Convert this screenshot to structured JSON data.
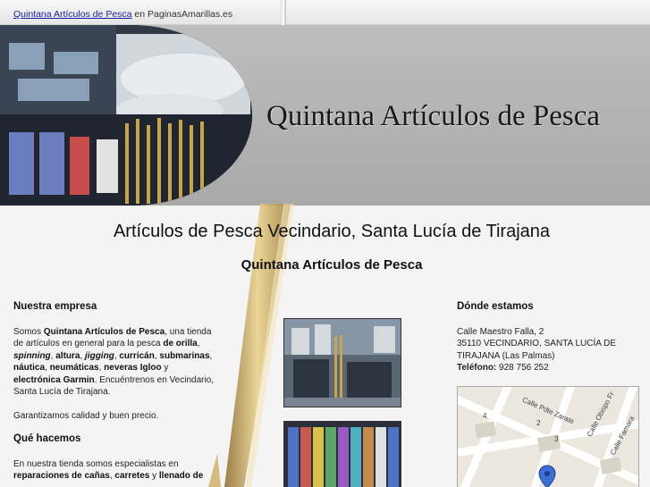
{
  "topbar": {
    "link_text": "Quintana Artículos de Pesca",
    "suffix_text": " en PaginasAmarillas.es"
  },
  "banner": {
    "title": "Quintana Artículos de Pesca"
  },
  "main": {
    "heading": "Artículos de Pesca Vecindario, Santa Lucía de Tirajana",
    "subheading": "Quintana Artículos de Pesca"
  },
  "empresa": {
    "title": "Nuestra empresa",
    "p1": [
      {
        "t": "Somos ",
        "b": false
      },
      {
        "t": "Quintana Artículos de Pesca",
        "b": true
      },
      {
        "t": ", una tienda de artículos en general para la pesca ",
        "b": false
      },
      {
        "t": "de orilla",
        "b": true
      },
      {
        "t": ", ",
        "b": false
      },
      {
        "t": "spinning",
        "b": true,
        "i": true
      },
      {
        "t": ", ",
        "b": false
      },
      {
        "t": "altura",
        "b": true
      },
      {
        "t": ", ",
        "b": false
      },
      {
        "t": "jigging",
        "b": true,
        "i": true
      },
      {
        "t": ", ",
        "b": false
      },
      {
        "t": "curricán",
        "b": true
      },
      {
        "t": ", ",
        "b": false
      },
      {
        "t": "submarinas",
        "b": true
      },
      {
        "t": ", ",
        "b": false
      },
      {
        "t": "náutica",
        "b": true
      },
      {
        "t": ", ",
        "b": false
      },
      {
        "t": "neumáticas",
        "b": true
      },
      {
        "t": ", ",
        "b": false
      },
      {
        "t": "neveras Igloo",
        "b": true
      },
      {
        "t": " y ",
        "b": false
      },
      {
        "t": "electrónica Garmin",
        "b": true
      },
      {
        "t": ". Encuéntrenos en Vecindario, Santa Lucía de Tirajana.",
        "b": false
      }
    ],
    "p2": "Garantizamos calidad y buen precio."
  },
  "hacemos": {
    "title": "Qué hacemos",
    "p1": [
      {
        "t": "En nuestra tienda somos especialistas en ",
        "b": false
      },
      {
        "t": "reparaciones de cañas",
        "b": true
      },
      {
        "t": ", ",
        "b": false
      },
      {
        "t": "carretes",
        "b": true
      },
      {
        "t": " y ",
        "b": false
      },
      {
        "t": "llenado de",
        "b": true
      }
    ]
  },
  "donde": {
    "title": "Dónde estamos",
    "line1": "Calle Maestro Falla, 2",
    "line2": "35110 VECINDARIO, SANTA LUCÍA DE TIRAJANA (Las Palmas)",
    "phone_label": "Teléfono:",
    "phone": " 928 756 252"
  },
  "map": {
    "streets": [
      "Calle Pdte Zarate",
      "Calle Obispo Fr",
      "Calle Famara"
    ],
    "numbers": [
      "4",
      "2",
      "3"
    ],
    "pin_color": "#3a6fd8"
  },
  "colors": {
    "link": "#1a1aa6",
    "banner_bg": "#b3b3b3"
  }
}
